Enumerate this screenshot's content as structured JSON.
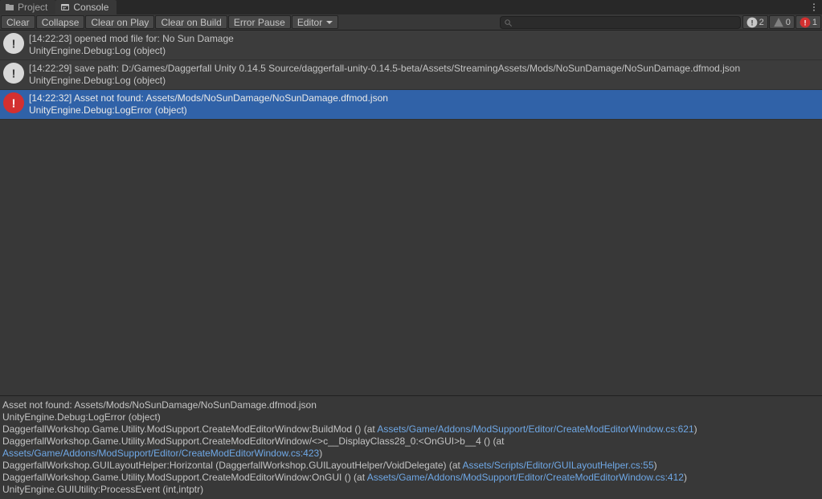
{
  "tabs": {
    "project": "Project",
    "console": "Console"
  },
  "toolbar": {
    "clear": "Clear",
    "collapse": "Collapse",
    "clear_on_play": "Clear on Play",
    "clear_on_build": "Clear on Build",
    "error_pause": "Error Pause",
    "editor": "Editor"
  },
  "counts": {
    "info": "2",
    "warn": "0",
    "error": "1"
  },
  "log": {
    "e0": {
      "line1": "[14:22:23] opened mod file for: No Sun Damage",
      "line2": "UnityEngine.Debug:Log (object)"
    },
    "e1": {
      "line1": "[14:22:29] save path: D:/Games/Daggerfall Unity 0.14.5 Source/daggerfall-unity-0.14.5-beta/Assets/StreamingAssets/Mods/NoSunDamage/NoSunDamage.dfmod.json",
      "line2": "UnityEngine.Debug:Log (object)"
    },
    "e2": {
      "line1": "[14:22:32] Asset not found: Assets/Mods/NoSunDamage/NoSunDamage.dfmod.json",
      "line2": "UnityEngine.Debug:LogError (object)"
    }
  },
  "detail": {
    "d0": "Asset not found: Assets/Mods/NoSunDamage/NoSunDamage.dfmod.json",
    "d1": "UnityEngine.Debug:LogError (object)",
    "d2a": "DaggerfallWorkshop.Game.Utility.ModSupport.CreateModEditorWindow:BuildMod () (at ",
    "d2link": "Assets/Game/Addons/ModSupport/Editor/CreateModEditorWindow.cs:621",
    "d2b": ")",
    "d3a": "DaggerfallWorkshop.Game.Utility.ModSupport.CreateModEditorWindow/<>c__DisplayClass28_0:<OnGUI>b__4 () (at ",
    "d3link": "Assets/Game/Addons/ModSupport/Editor/CreateModEditorWindow.cs:423",
    "d3b": ")",
    "d4a": "DaggerfallWorkshop.GUILayoutHelper:Horizontal (DaggerfallWorkshop.GUILayoutHelper/VoidDelegate) (at ",
    "d4link": "Assets/Scripts/Editor/GUILayoutHelper.cs:55",
    "d4b": ")",
    "d5a": "DaggerfallWorkshop.Game.Utility.ModSupport.CreateModEditorWindow:OnGUI () (at ",
    "d5link": "Assets/Game/Addons/ModSupport/Editor/CreateModEditorWindow.cs:412",
    "d5b": ")",
    "d6": "UnityEngine.GUIUtility:ProcessEvent (int,intptr)"
  }
}
